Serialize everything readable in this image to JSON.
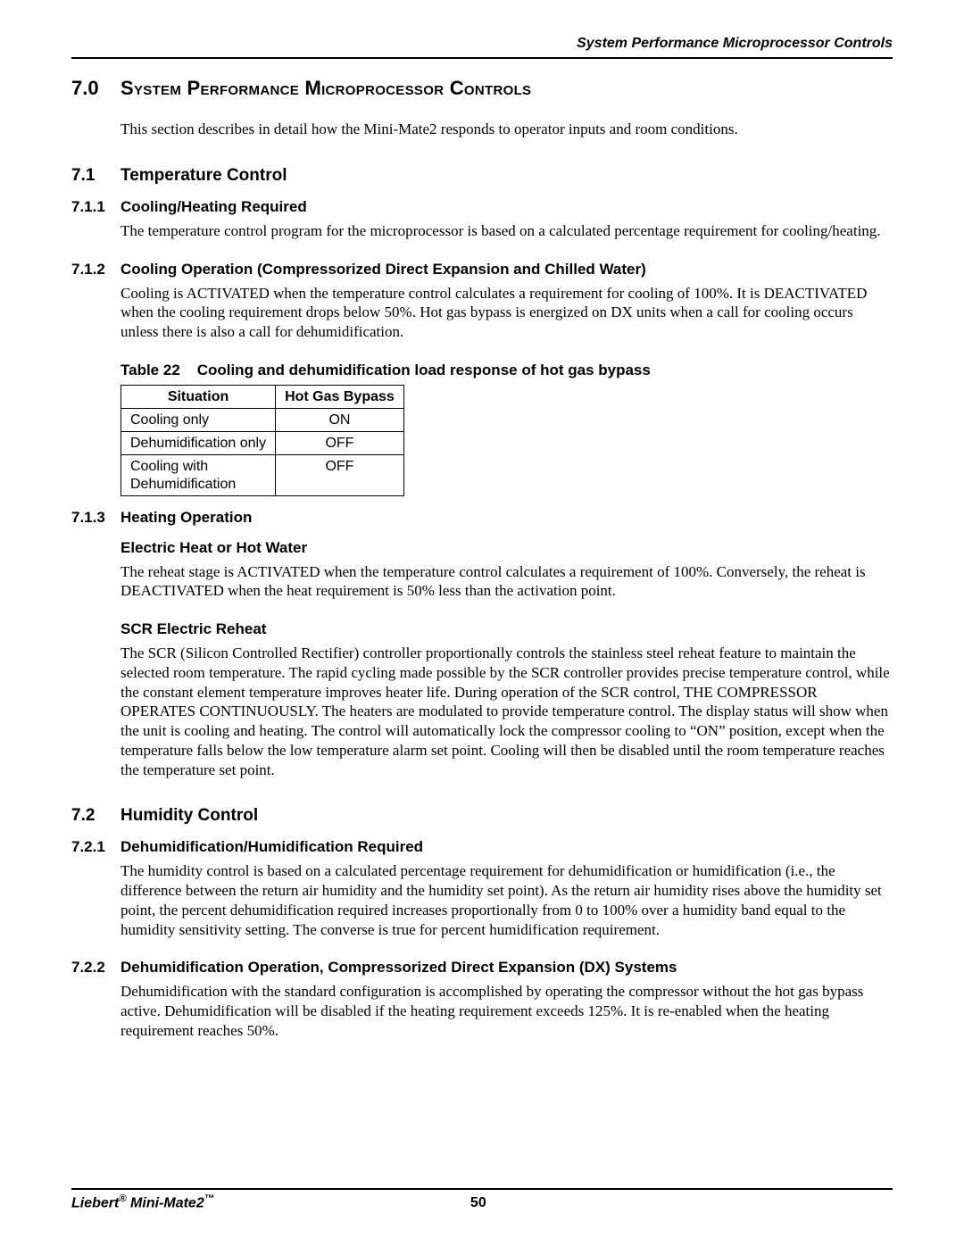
{
  "running_head": "System Performance Microprocessor Controls",
  "h1": {
    "num": "7.0",
    "title": "System Performance Microprocessor Controls"
  },
  "intro": "This section describes in detail how the Mini-Mate2 responds to operator inputs and room conditions.",
  "s71": {
    "num": "7.1",
    "title": "Temperature Control"
  },
  "s711": {
    "num": "7.1.1",
    "title": "Cooling/Heating Required",
    "para": "The temperature control program for the microprocessor is based on a calculated percentage requirement for cooling/heating."
  },
  "s712": {
    "num": "7.1.2",
    "title": "Cooling Operation (Compressorized Direct Expansion and Chilled Water)",
    "para": "Cooling is ACTIVATED when the temperature control calculates a requirement for cooling of 100%. It is DEACTIVATED when the cooling requirement drops below 50%. Hot gas bypass is energized on DX units when a call for cooling occurs unless there is also a call for dehumidification."
  },
  "table22": {
    "label": "Table 22",
    "caption": "Cooling and dehumidification load response of hot gas bypass",
    "headers": [
      "Situation",
      "Hot Gas Bypass"
    ],
    "rows": [
      [
        "Cooling only",
        "ON"
      ],
      [
        "Dehumidification only",
        "OFF"
      ],
      [
        "Cooling with Dehumidification",
        "OFF"
      ]
    ]
  },
  "s713": {
    "num": "7.1.3",
    "title": "Heating Operation",
    "sub1": "Electric Heat or Hot Water",
    "para1": "The reheat stage is ACTIVATED when the temperature control calculates a requirement of 100%. Conversely, the reheat is DEACTIVATED when the heat requirement is 50% less than the activation point.",
    "sub2": "SCR Electric Reheat",
    "para2": "The SCR (Silicon Controlled Rectifier) controller proportionally controls the stainless steel reheat feature to maintain the selected room temperature. The rapid cycling made possible by the SCR controller provides precise temperature control, while the constant element temperature improves heater life. During operation of the SCR control, THE COMPRESSOR OPERATES CONTINUOUSLY. The heaters are modulated to provide temperature control. The display status will show when the unit is cooling and heating.   The control will automatically lock the compressor cooling to “ON” position, except when the temperature falls below the low temperature alarm set point. Cooling will then be disabled until the room temperature reaches the temperature set point."
  },
  "s72": {
    "num": "7.2",
    "title": "Humidity Control"
  },
  "s721": {
    "num": "7.2.1",
    "title": "Dehumidification/Humidification Required",
    "para": "The humidity control is based on a calculated percentage requirement for dehumidification or humidification (i.e., the difference between the return air humidity and the humidity set point). As the return air humidity rises above the humidity set point, the percent dehumidification required increases proportionally from 0 to 100% over a humidity band equal to the humidity sensitivity setting. The converse is true for percent humidification requirement."
  },
  "s722": {
    "num": "7.2.2",
    "title": "Dehumidification Operation, Compressorized Direct Expansion (DX) Systems",
    "para": "Dehumidification with the standard configuration is accomplished by operating the compressor without the hot gas bypass active. Dehumidification will be disabled if the heating requirement exceeds 125%. It is re-enabled when the heating requirement reaches 50%."
  },
  "footer": {
    "left_pre": "Liebert",
    "left_mid": " Mini-Mate2",
    "page": "50"
  }
}
